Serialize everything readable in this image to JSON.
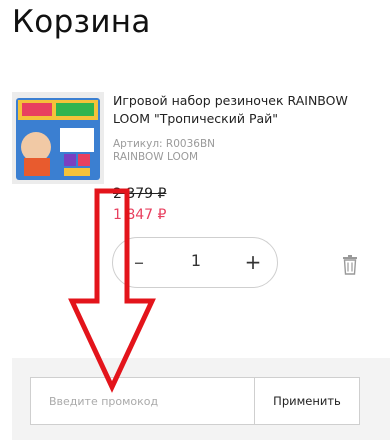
{
  "page": {
    "title": "Корзина"
  },
  "cart_item": {
    "image_icon": "product-photo",
    "name": "Игровой набор резиночек RAINBOW LOOM \"Тропический Рай\"",
    "sku": "Артикул: R0036BN",
    "brand": "RAINBOW LOOM",
    "price_old": "2 379 ₽",
    "price_new": "1 847 ₽",
    "quantity": "1",
    "minus_label": "–",
    "plus_label": "+",
    "delete_icon": "trash-icon"
  },
  "promo": {
    "placeholder": "Введите промокод",
    "apply_label": "Применить"
  },
  "colors": {
    "accent_price": "#e8405f",
    "arrow": "#e3141b"
  }
}
